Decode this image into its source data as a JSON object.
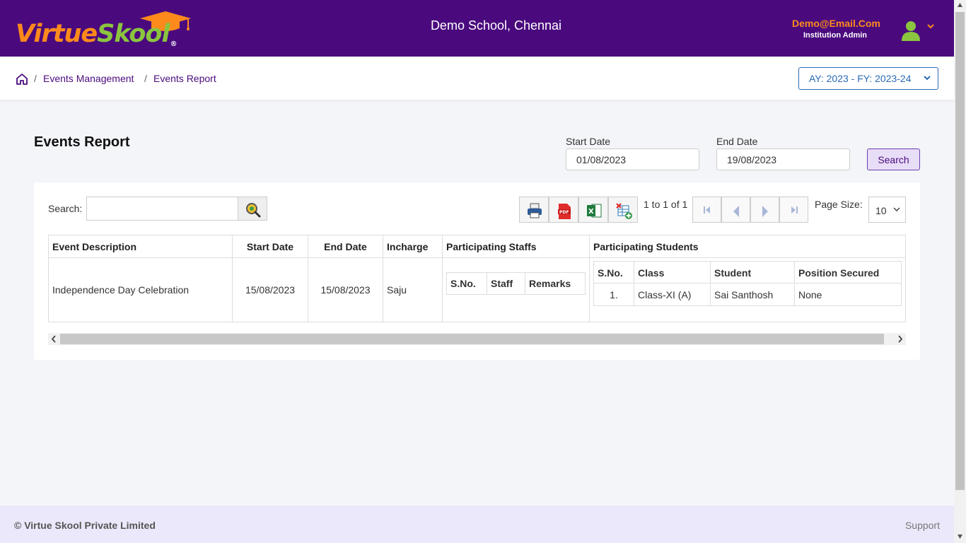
{
  "brand": {
    "name_part1": "Virtue",
    "name_part2": "Skool",
    "registered": "®",
    "primary_color": "#4a0a7e",
    "accent_orange": "#ff8a1c",
    "accent_green": "#8bc53f"
  },
  "header": {
    "school_name": "Demo School, Chennai",
    "user_email": "Demo@Email.Com",
    "user_role": "Institution Admin",
    "avatar_icon": "user-avatar-icon",
    "dropdown_icon": "chevron-down-icon"
  },
  "breadcrumb": {
    "home_icon": "home-icon",
    "items": [
      "Events Management",
      "Events Report"
    ],
    "separator": "/"
  },
  "academic_year": {
    "selected": "AY: 2023 - FY: 2023-24"
  },
  "page": {
    "title": "Events Report",
    "start_date_label": "Start Date",
    "start_date_value": "01/08/2023",
    "end_date_label": "End Date",
    "end_date_value": "19/08/2023",
    "search_button": "Search"
  },
  "grid_toolbar": {
    "search_label": "Search:",
    "search_value": "",
    "export_buttons": [
      "print-icon",
      "pdf-icon",
      "excel-icon",
      "add-sheet-icon"
    ],
    "pager_info": "1 to 1 of 1",
    "page_size_label": "Page Size:",
    "page_size_value": "10"
  },
  "grid": {
    "headers": [
      "Event Description",
      "Start Date",
      "End Date",
      "Incharge",
      "Participating Staffs",
      "Participating Students"
    ],
    "rows": [
      {
        "event_description": "Independence Day Celebration",
        "start_date": "15/08/2023",
        "end_date": "15/08/2023",
        "incharge": "Saju",
        "staffs": {
          "headers": [
            "S.No.",
            "Staff",
            "Remarks"
          ],
          "rows": []
        },
        "students": {
          "headers": [
            "S.No.",
            "Class",
            "Student",
            "Position Secured"
          ],
          "rows": [
            [
              "1.",
              "Class-XI (A)",
              "Sai Santhosh",
              "None"
            ]
          ]
        }
      }
    ]
  },
  "footer": {
    "copyright": "© Virtue Skool Private Limited",
    "support": "Support"
  }
}
